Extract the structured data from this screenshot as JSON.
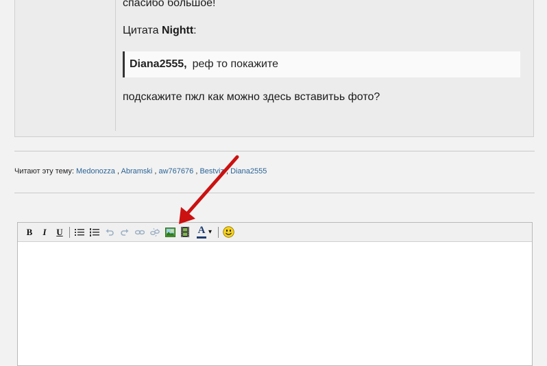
{
  "post": {
    "line1": "спасибо большое!",
    "quote_prefix": "Цитата",
    "quote_author": "Nightt",
    "quote_suffix": ":",
    "quote_user": "Diana2555,",
    "quote_text": "реф то покажите",
    "question": "подскажите пжл как можно здесь вставитьь фото?"
  },
  "readers": {
    "label": "Читают эту тему:",
    "users": [
      "Medonozza",
      "Abramski",
      "aw767676",
      "Bestviz",
      "Diana2555"
    ],
    "separator": " , "
  },
  "toolbar": {
    "bold": "B",
    "italic": "I",
    "underline": "U",
    "font_color": "A",
    "font_color_dropdown": "▾"
  },
  "annotation": {
    "arrow_color": "#cc1111"
  }
}
